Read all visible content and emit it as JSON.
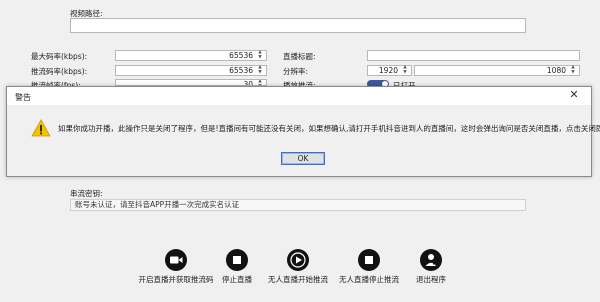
{
  "form": {
    "video_path_label": "视频路径:",
    "max_bitrate_label": "最大码率(kbps):",
    "max_bitrate_value": "65536",
    "push_bitrate_label": "推流码率(kbps):",
    "push_bitrate_value": "65536",
    "push_fps_label": "推流帧率(fps):",
    "push_fps_value": "30",
    "live_title_label": "直播标题:",
    "resolution_label": "分辨率:",
    "resolution_width": "1920",
    "resolution_height": "1080",
    "bypass_label": "播放推流:",
    "bypass_state": "已打开",
    "stream_key_label": "串流密钥:",
    "stream_key_value": "账号未认证，请至抖音APP开播一次完成实名认证"
  },
  "dialog": {
    "title": "警告",
    "message": "如果你成功开播，此操作只是关闭了程序，但是!直播间有可能还没有关闭，如果想确认,请打开手机抖音进到人的直播间，这时会弹出询问是否关闭直播，点击关闭即可!",
    "ok_label": "OK"
  },
  "toolbar": {
    "start_label": "开启直播并获取推流码",
    "stop_label": "停止直播",
    "unmanned_start_label": "无人直播开始推流",
    "unmanned_stop_label": "无人直播停止推流",
    "exit_label": "退出程序"
  },
  "colors": {
    "accent": "#3a5a9a",
    "warning": "#f2c200",
    "ok_border": "#3c6ed1"
  }
}
